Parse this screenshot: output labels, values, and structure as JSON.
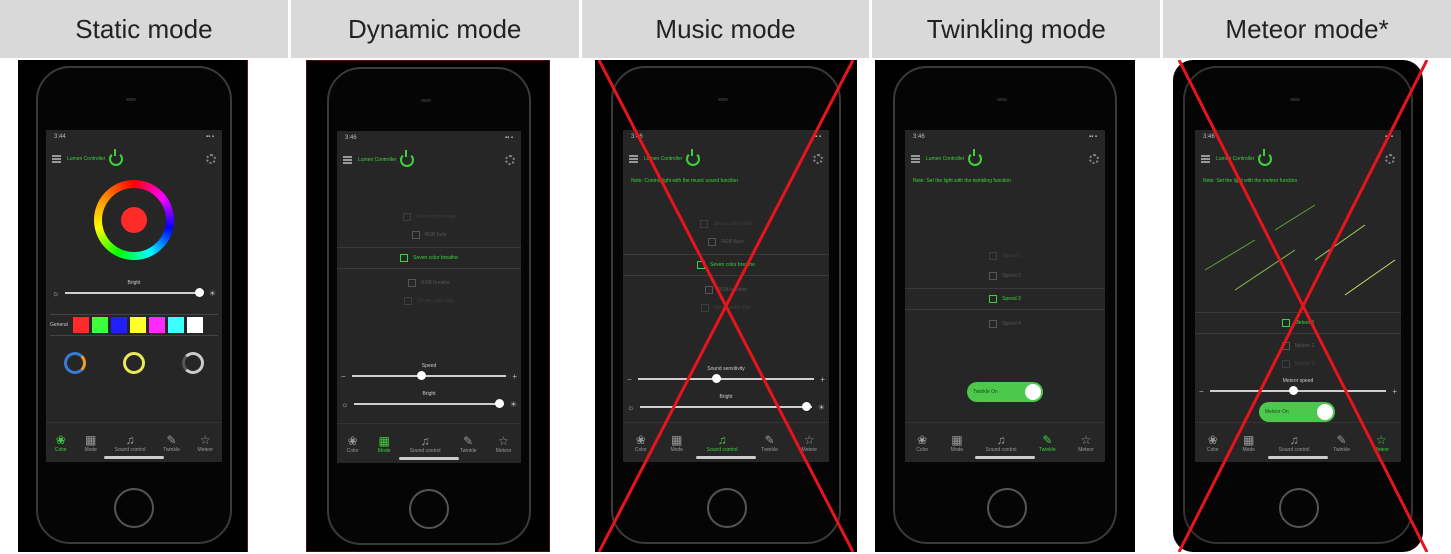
{
  "modes": [
    {
      "title": "Static mode"
    },
    {
      "title": "Dynamic mode"
    },
    {
      "title": "Music mode"
    },
    {
      "title": "Twinkling mode"
    },
    {
      "title": "Meteor mode*"
    }
  ],
  "accent_color": "#3dd13d",
  "cross_color": "#e8141c",
  "static_panel": {
    "status_time": "3:44",
    "slider_label": "Bright",
    "preset_label": "General",
    "swatches": [
      "#ff2a2a",
      "#3dff3d",
      "#2020ff",
      "#ffff2a",
      "#ff2aff",
      "#3dffff",
      "#ffffff"
    ],
    "ring_colors": [
      "#3a7bd5",
      "#e8e85a",
      "#cccccc"
    ],
    "center_color": "#ff2a2a"
  },
  "dynamic_panel": {
    "status_time": "3:46",
    "items": [
      "Seven color swap",
      "RGB fade",
      "Seven color breathe",
      "RGB breathe",
      "Seven color skip"
    ],
    "selected_index": 2,
    "speed_label": "Speed",
    "bright_label": "Bright",
    "speed_level": 0.42,
    "bright_level": 0.95
  },
  "music_panel": {
    "status_time": "3:46",
    "hint": "Note: Control light with the music sound function",
    "items": [
      "Seven color flash",
      "RGB flash",
      "Seven color breathe",
      "RGB breathe",
      "Seven color skip"
    ],
    "selected_index": 2,
    "sens_label": "Sound sensitivity",
    "bright_label": "Bright",
    "sens_level": 0.42,
    "bright_level": 0.95
  },
  "twinkle_panel": {
    "status_time": "3:46",
    "hint": "Note: Set the light with the twinkling function",
    "items": [
      "Speed 1",
      "Speed 2",
      "Speed 3",
      "Speed 4"
    ],
    "selected_index": 2,
    "toggle_label": "Twinkle On"
  },
  "meteor_panel": {
    "status_time": "3:46",
    "hint": "Note: Set the light with the meteor function",
    "items": [
      "Meteor 1",
      "Meteor 2",
      "Meteor 3"
    ],
    "selected_index": 0,
    "speed_label": "Meteor speed",
    "speed_level": 0.45,
    "toggle_label": "Meteor On"
  },
  "tabs": [
    "Color",
    "Mode",
    "Sound control",
    "Twinkle",
    "Meteor"
  ],
  "device_name": "Lumen Controller"
}
